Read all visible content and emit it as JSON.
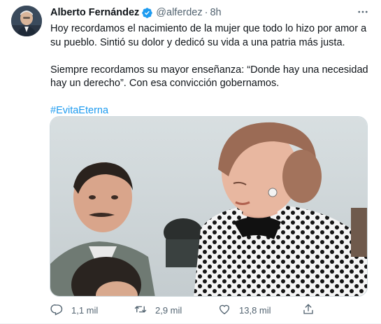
{
  "tweet": {
    "author_name": "Alberto Fernández",
    "handle": "@alferdez",
    "separator": "·",
    "time": "8h",
    "text_line1": "Hoy recordamos el nacimiento de la mujer que todo lo hizo por amor a su pueblo. Sintió su dolor y dedicó su vida a una patria más justa.",
    "text_line2": "Siempre recordamos su mayor enseñanza: “Donde hay una necesidad hay un derecho”. Con esa convicción gobernamos.",
    "hashtag": "#EvitaEterna"
  },
  "actions": {
    "replies": "1,1 mil",
    "retweets": "2,9 mil",
    "likes": "13,8 mil"
  },
  "colors": {
    "accent": "#1d9bf0",
    "secondary_text": "#536471"
  },
  "icons": [
    "verified-badge-icon",
    "more-icon",
    "reply-icon",
    "retweet-icon",
    "like-icon",
    "share-icon"
  ]
}
